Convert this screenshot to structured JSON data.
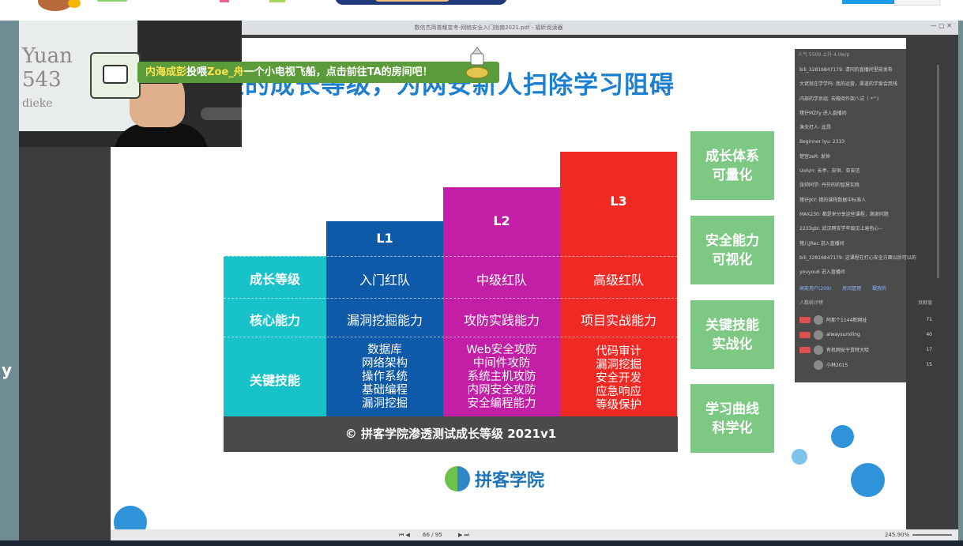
{
  "viewer": {
    "title": "数信杰简普耀变考-网络安全入门指南2021.pdf - 福昕阅读器",
    "page_indicator": "66 / 95",
    "zoom": "245.90%"
  },
  "slide": {
    "headline": "循序渐进的成长等级，为网安新人扫除学习阻碍",
    "row_labels": {
      "level": "成长等级",
      "ability": "核心能力",
      "skills": "关键技能"
    },
    "columns": [
      {
        "level": "L1",
        "rank": "入门红队",
        "ability": "漏洞挖掘能力",
        "skills": [
          "数据库",
          "网络架构",
          "操作系统",
          "基础编程",
          "漏洞挖掘"
        ]
      },
      {
        "level": "L2",
        "rank": "中级红队",
        "ability": "攻防实践能力",
        "skills": [
          "Web安全攻防",
          "中间件攻防",
          "系统主机攻防",
          "内网安全攻防",
          "安全编程能力"
        ]
      },
      {
        "level": "L3",
        "rank": "高级红队",
        "ability": "项目实战能力",
        "skills": [
          "代码审计",
          "漏洞挖掘",
          "安全开发",
          "应急响应",
          "等级保护"
        ]
      }
    ],
    "footer": "© 拼客学院渗透测试成长等级 2021v1",
    "side_boxes": [
      {
        "line1": "成长体系",
        "line2": "可量化"
      },
      {
        "line1": "安全能力",
        "line2": "可视化"
      },
      {
        "line1": "关键技能",
        "line2": "实战化"
      },
      {
        "line1": "学习曲线",
        "line2": "科学化"
      }
    ],
    "brand": "拼客学院",
    "colors": {
      "teal": "#17c3c8",
      "blue": "#0f5aa8",
      "magenta": "#c21fa6",
      "red": "#ef2a24",
      "green": "#7dc882",
      "headline": "#1d7fd0"
    }
  },
  "webcam": {
    "whiteboard_lines": [
      "Yuan",
      "543",
      "dieke"
    ]
  },
  "gift_banner": {
    "sender": "内海成彭",
    "action": "投喂",
    "target": "Zoe_舟",
    "rest": "一个小电视飞船，点击前往TA的房间吧！"
  },
  "chat": {
    "header": "人气 5509    上升 4.0w/p",
    "messages": [
      "bili_32816847179: 请问的直播间里能发布",
      "大佬就在学学吗: 我的运营，渠道的学爱会用钱",
      "内部的学员组: 去做阅作架八试（ *^)",
      "猪仔MZFy 进入直播间",
      "渔夫打人: 此昂",
      "Beginner lyu: 2333",
      "楚宫zeR: 发钟",
      "Uoh/rr: 长亭、安恒、亚安信",
      "张帅同学: 丹芬的的智慧实践",
      "猪仔JKY: 猜的课程数据中标准人",
      "MAX230: 都是来分享这些课程，谢谢问题",
      "2233gbi: 武汉网安学年级见上易色心--",
      "猪儿JRec 进入直播间",
      "bili_32816847179: 这课程在打心安全方面以后可以的",
      "youyou6 进入直播间"
    ],
    "tabs": [
      "高能用户(209)",
      "房间管理",
      "戳我的"
    ],
    "rank_header": "人数统计榜",
    "rank_right": "贡献值",
    "rank": [
      {
        "name": "阿那个1144新网址",
        "value": "71"
      },
      {
        "name": "alwaysumiling",
        "value": "40"
      },
      {
        "name": "有机网安干货特大哈",
        "value": "17"
      },
      {
        "name": "小林2015",
        "value": "15"
      }
    ]
  },
  "left_glyph": "y"
}
